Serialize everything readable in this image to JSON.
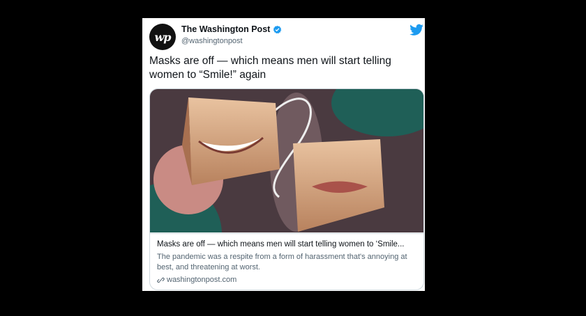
{
  "tweet": {
    "author_name": "The Washington Post",
    "author_handle": "@washingtonpost",
    "avatar_letters": "wp",
    "text": "Masks are off — which means men will start telling women to “Smile!” again"
  },
  "card": {
    "title": "Masks are off — which means men will start telling women to ‘Smile...",
    "description": "The pandemic was a respite from a form of harassment that's annoying at best, and threatening at worst.",
    "domain": "washingtonpost.com"
  },
  "icons": {
    "verified": "verified-badge-icon",
    "brand": "twitter-bird-icon",
    "link": "link-icon"
  },
  "colors": {
    "twitter_blue": "#1d9bf0",
    "image_bg": "#4a3a40",
    "teal_blob": "#1f5f57",
    "pink_circle": "#c98b84",
    "mask_tan": "#d8a880"
  }
}
